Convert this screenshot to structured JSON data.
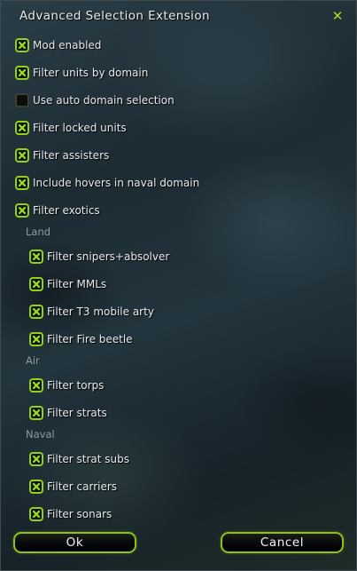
{
  "window": {
    "title": "Advanced Selection Extension",
    "close_glyph": "✕",
    "accent_color": "#94cf1c"
  },
  "options": [
    {
      "label": "Mod enabled",
      "checked": true
    },
    {
      "label": "Filter units by domain",
      "checked": true
    },
    {
      "label": "Use auto domain selection",
      "checked": false
    },
    {
      "label": "Filter locked units",
      "checked": true
    },
    {
      "label": "Filter assisters",
      "checked": true
    },
    {
      "label": "Include hovers in naval domain",
      "checked": true
    },
    {
      "label": "Filter exotics",
      "checked": true
    }
  ],
  "sections": {
    "land": {
      "heading": "Land",
      "items": [
        {
          "label": "Filter snipers+absolver",
          "checked": true
        },
        {
          "label": "Filter MMLs",
          "checked": true
        },
        {
          "label": "Filter T3 mobile arty",
          "checked": true
        },
        {
          "label": "Filter Fire beetle",
          "checked": true
        }
      ]
    },
    "air": {
      "heading": "Air",
      "items": [
        {
          "label": "Filter torps",
          "checked": true
        },
        {
          "label": "Filter strats",
          "checked": true
        }
      ]
    },
    "naval": {
      "heading": "Naval",
      "items": [
        {
          "label": "Filter strat subs",
          "checked": true
        },
        {
          "label": "Filter carriers",
          "checked": true
        },
        {
          "label": "Filter sonars",
          "checked": true
        }
      ]
    }
  },
  "buttons": {
    "ok_label": "Ok",
    "cancel_label": "Cancel"
  }
}
